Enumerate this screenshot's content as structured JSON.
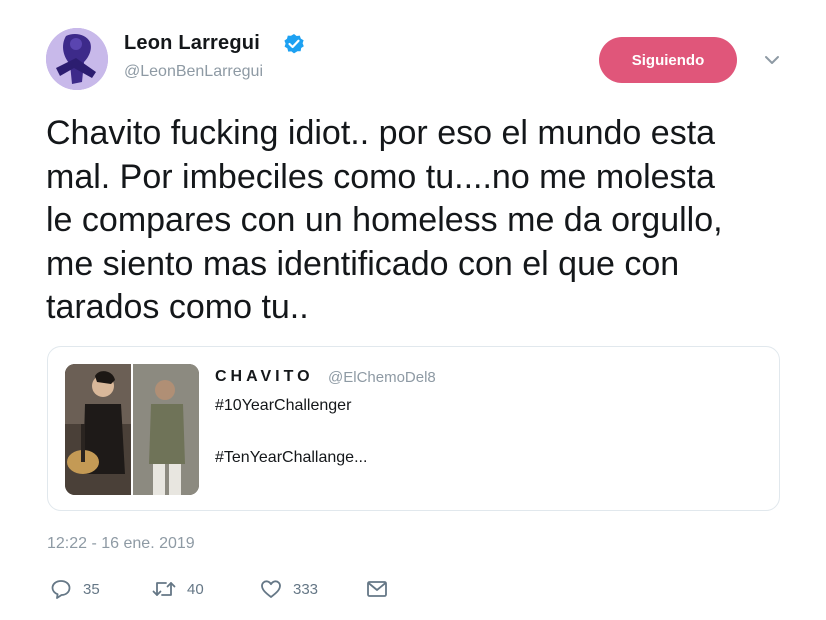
{
  "author": {
    "display_name": "Leon Larregui",
    "handle": "@LeonBenLarregui",
    "verified": true,
    "follow_label": "Siguiendo"
  },
  "tweet": {
    "text": "Chavito fucking idiot.. por eso el mundo esta\nmal. Por imbeciles como tu....no me molesta\nle compares con un homeless me da orgullo,\nme siento mas identificado con el que con\ntarados como tu..",
    "timestamp": "12:22 - 16 ene. 2019"
  },
  "quoted_tweet": {
    "display_name": "CHAVITO",
    "handle": "@ElChemoDel8",
    "line1": "#10YearChallenger",
    "line2": "#TenYearChallange..."
  },
  "actions": {
    "reply_count": "35",
    "retweet_count": "40",
    "like_count": "333"
  },
  "icons": {
    "verified": "verified-badge-icon",
    "caret": "chevron-down-icon",
    "reply": "reply-icon",
    "retweet": "retweet-icon",
    "like": "heart-icon",
    "dm": "envelope-icon"
  },
  "colors": {
    "follow_button": "#e0567a",
    "verified_blue": "#1da1f2",
    "secondary_text": "#8e9aa4"
  }
}
